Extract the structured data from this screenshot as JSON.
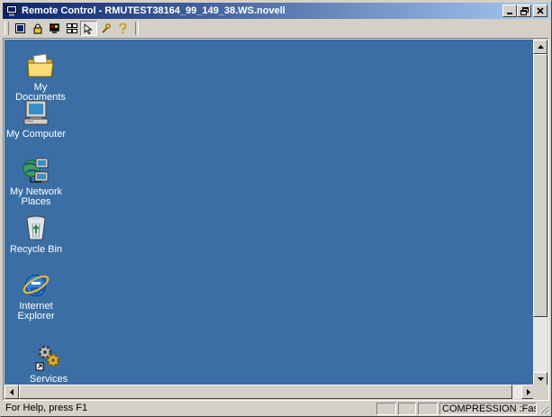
{
  "window": {
    "title": "Remote Control - RMUTEST38164_99_149_38.WS.novell",
    "controls": {
      "minimize_icon": "minimize-icon",
      "restore_icon": "restore-icon",
      "close_icon": "close-icon"
    }
  },
  "toolbar": {
    "buttons": [
      {
        "icon": "fullscreen-icon"
      },
      {
        "icon": "lock-icon"
      },
      {
        "icon": "blank-screen-icon"
      },
      {
        "icon": "tile-windows-icon"
      },
      {
        "icon": "navigation-icon",
        "pressed": true
      },
      {
        "icon": "settings-wrench-icon"
      },
      {
        "icon": "help-icon"
      }
    ]
  },
  "desktop": {
    "background": "#3a6ea5",
    "icons": [
      {
        "label": "My Documents",
        "icon": "folder-icon"
      },
      {
        "label": "My Computer",
        "icon": "computer-icon"
      },
      {
        "label": "My Network Places",
        "icon": "network-icon"
      },
      {
        "label": "Recycle Bin",
        "icon": "recycle-bin-icon"
      },
      {
        "label": "Internet Explorer",
        "icon": "internet-explorer-icon"
      },
      {
        "label": "Services",
        "icon": "services-icon"
      }
    ]
  },
  "statusbar": {
    "help_text": "For Help, press F1",
    "compression": "COMPRESSION :Fast"
  }
}
